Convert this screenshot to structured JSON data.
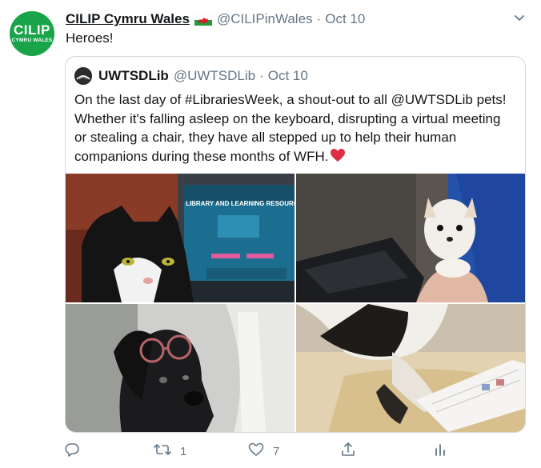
{
  "tweet": {
    "avatar": {
      "line1": "CILIP",
      "line2": "CYMRU WALES",
      "color": "#19a44a"
    },
    "display_name": "CILIP Cymru Wales",
    "flag_icon": "wales-flag-icon",
    "handle": "@CILIPinWales",
    "separator": "·",
    "date": "Oct 10",
    "text": "Heroes!",
    "more_icon": "chevron-down-icon"
  },
  "quoted": {
    "display_name": "UWTSDLib",
    "handle": "@UWTSDLib",
    "separator": "·",
    "date": "Oct 10",
    "text": "On the last day of #LibrariesWeek, a shout-out to all @UWTSDLib pets! Whether it's falling asleep on the keyboard, disrupting a virtual meeting or stealing a chair, they have all stepped up to help their human companions during these months of WFH.",
    "emoji": "red-heart-icon",
    "photos": [
      {
        "name": "cat-on-keyboard-photo",
        "screen_text": "LIBRARY AND LEARNING RESOURCES"
      },
      {
        "name": "chihuahua-on-lap-photo"
      },
      {
        "name": "dog-with-glasses-photo"
      },
      {
        "name": "dog-on-table-photo"
      }
    ]
  },
  "actions": {
    "reply": {
      "icon": "reply-icon",
      "count": ""
    },
    "retweet": {
      "icon": "retweet-icon",
      "count": "1"
    },
    "like": {
      "icon": "heart-icon",
      "count": "7"
    },
    "share": {
      "icon": "share-icon"
    },
    "analytics": {
      "icon": "analytics-icon"
    }
  },
  "colors": {
    "text": "#14171a",
    "secondary": "#657786",
    "border": "#cfd9de",
    "heart": "#e0245e"
  }
}
